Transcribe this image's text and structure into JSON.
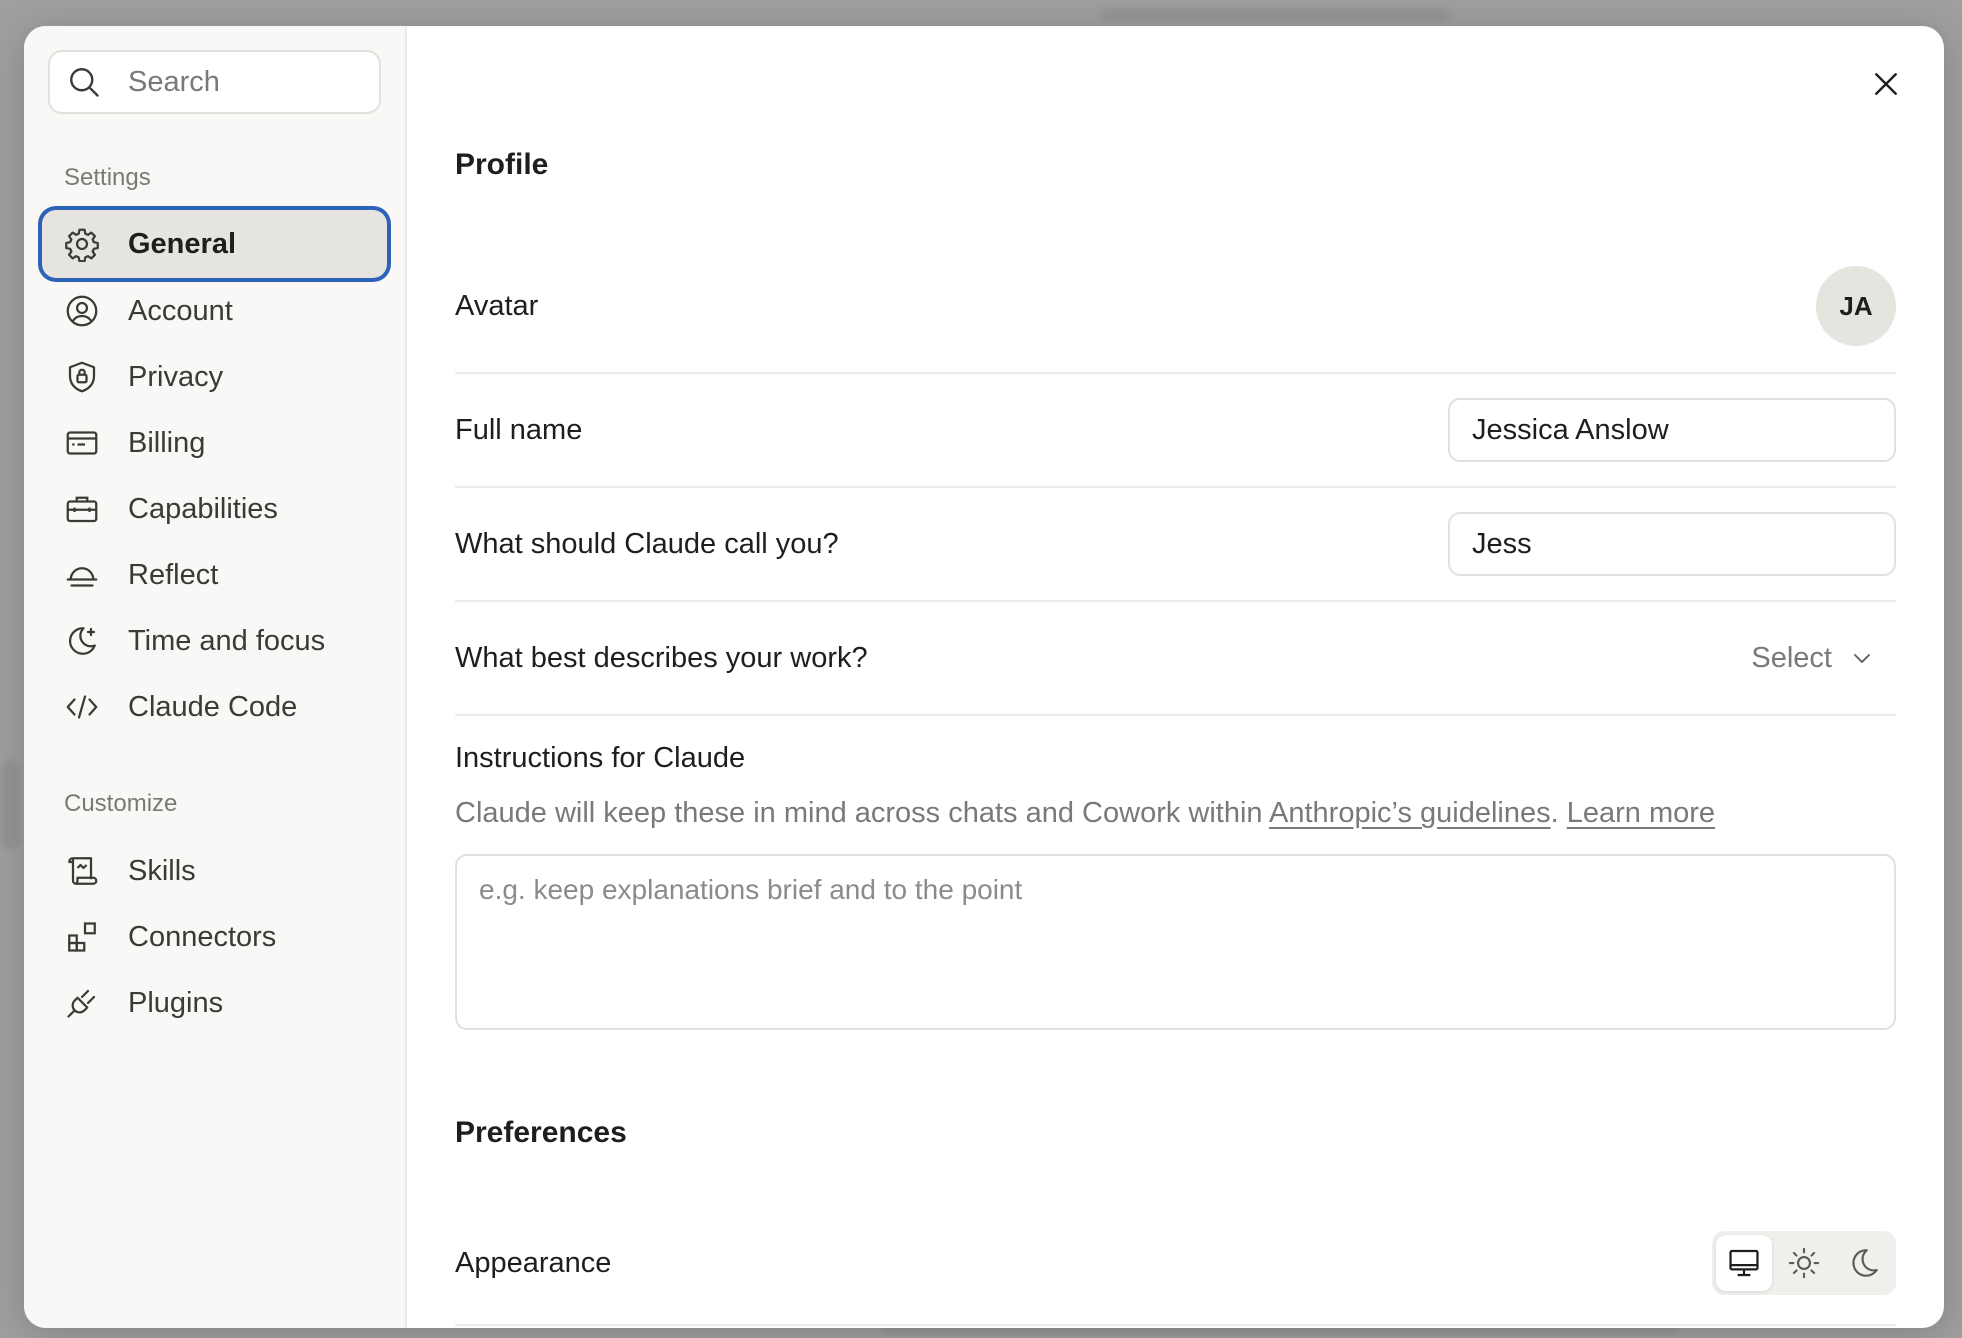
{
  "sidebar": {
    "search_placeholder": "Search",
    "settings_label": "Settings",
    "customize_label": "Customize",
    "settings_items": [
      {
        "label": "General",
        "icon": "gear-icon",
        "active": true
      },
      {
        "label": "Account",
        "icon": "user-circle-icon"
      },
      {
        "label": "Privacy",
        "icon": "shield-lock-icon"
      },
      {
        "label": "Billing",
        "icon": "credit-card-icon"
      },
      {
        "label": "Capabilities",
        "icon": "briefcase-icon"
      },
      {
        "label": "Reflect",
        "icon": "horizon-icon"
      },
      {
        "label": "Time and focus",
        "icon": "moon-sparkle-icon"
      },
      {
        "label": "Claude Code",
        "icon": "code-icon"
      }
    ],
    "customize_items": [
      {
        "label": "Skills",
        "icon": "scroll-icon"
      },
      {
        "label": "Connectors",
        "icon": "blocks-icon"
      },
      {
        "label": "Plugins",
        "icon": "plug-icon"
      }
    ]
  },
  "profile": {
    "heading": "Profile",
    "avatar_label": "Avatar",
    "avatar_initials": "JA",
    "full_name_label": "Full name",
    "full_name_value": "Jessica Anslow",
    "call_label": "What should Claude call you?",
    "call_value": "Jess",
    "work_label": "What best describes your work?",
    "work_select": "Select",
    "instructions_title": "Instructions for Claude",
    "instructions_desc_prefix": "Claude will keep these in mind across chats and Cowork within ",
    "instructions_link_guidelines": "Anthropic’s guidelines",
    "instructions_desc_sep": ". ",
    "instructions_link_learn": "Learn more",
    "instructions_placeholder": "e.g. keep explanations brief and to the point"
  },
  "preferences": {
    "heading": "Preferences",
    "appearance_label": "Appearance",
    "appearance_options": [
      "monitor-icon",
      "sun-icon",
      "moon-icon"
    ],
    "appearance_selected": "monitor-icon"
  },
  "colors": {
    "accent_focus": "#2d62b8",
    "sidebar_bg": "#f9f8f6",
    "active_item_bg": "#e6e4df"
  }
}
